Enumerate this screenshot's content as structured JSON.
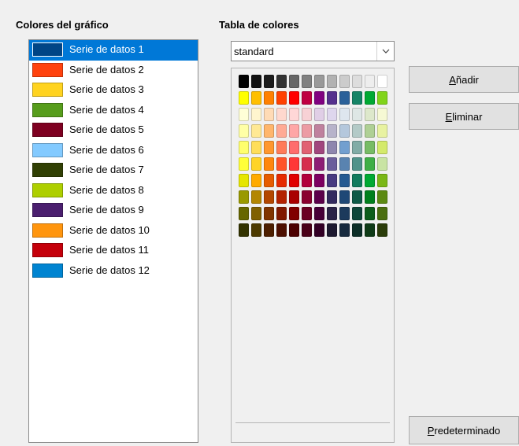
{
  "left_panel": {
    "title": "Colores del gráfico",
    "selected_index": 0,
    "series": [
      {
        "label": "Serie de datos 1",
        "color": "#004586"
      },
      {
        "label": "Serie de datos 2",
        "color": "#ff420e"
      },
      {
        "label": "Serie de datos 3",
        "color": "#ffd320"
      },
      {
        "label": "Serie de datos 4",
        "color": "#579d1c"
      },
      {
        "label": "Serie de datos 5",
        "color": "#7e0021"
      },
      {
        "label": "Serie de datos 6",
        "color": "#83caff"
      },
      {
        "label": "Serie de datos 7",
        "color": "#314004"
      },
      {
        "label": "Serie de datos 8",
        "color": "#aecf00"
      },
      {
        "label": "Serie de datos 9",
        "color": "#4b1f6f"
      },
      {
        "label": "Serie de datos 10",
        "color": "#ff950e"
      },
      {
        "label": "Serie de datos 11",
        "color": "#c5000b"
      },
      {
        "label": "Serie de datos 12",
        "color": "#0084d1"
      }
    ]
  },
  "right_panel": {
    "title": "Tabla de colores",
    "palette_select": {
      "value": "standard"
    },
    "palette_rows": [
      [
        "#000000",
        "#111111",
        "#1c1c1c",
        "#333333",
        "#666666",
        "#808080",
        "#999999",
        "#b2b2b2",
        "#cccccc",
        "#dddddd",
        "#eeeeee",
        "#ffffff"
      ],
      [
        "#ffff00",
        "#ffbf00",
        "#ff8000",
        "#ff4000",
        "#ff0000",
        "#bf0041",
        "#800080",
        "#55308d",
        "#2a6099",
        "#158466",
        "#00a933",
        "#81d41a"
      ],
      [
        "#ffffd7",
        "#fff5ce",
        "#ffdbb6",
        "#ffd8ce",
        "#ffd7d7",
        "#f7d1d5",
        "#e0cee6",
        "#ded6ed",
        "#dee6ef",
        "#dee7e5",
        "#dde8cb",
        "#f6f9d4"
      ],
      [
        "#ffffa6",
        "#ffe994",
        "#ffb66c",
        "#ffaa95",
        "#ffa6a6",
        "#ec9ba4",
        "#bf819e",
        "#b7b3ca",
        "#b4c7dc",
        "#b3cac7",
        "#afd095",
        "#e8f2a1"
      ],
      [
        "#ffff6d",
        "#ffde59",
        "#ff972f",
        "#ff7b59",
        "#ff6d6d",
        "#e16173",
        "#a1467e",
        "#8e86ae",
        "#729fcf",
        "#81aca6",
        "#77bc65",
        "#d4ea6b"
      ],
      [
        "#ffff38",
        "#ffd428",
        "#ff860d",
        "#ff5429",
        "#ff3838",
        "#d62e4e",
        "#8d1d75",
        "#6b5e9b",
        "#5983b0",
        "#50938a",
        "#3faf46",
        "#c9e4a4"
      ],
      [
        "#e6e600",
        "#ffaa00",
        "#e65c00",
        "#e62b00",
        "#e00000",
        "#b2003c",
        "#7d0061",
        "#473a80",
        "#265a91",
        "#137b5e",
        "#00a933",
        "#7ab717"
      ],
      [
        "#999900",
        "#b38600",
        "#b34700",
        "#b32200",
        "#a90000",
        "#8a002f",
        "#5c004a",
        "#332a5e",
        "#1f4876",
        "#0e5a47",
        "#00801d",
        "#5c8a12"
      ],
      [
        "#666600",
        "#806000",
        "#803400",
        "#801900",
        "#800000",
        "#6a0023",
        "#470038",
        "#2b2347",
        "#1c3a5c",
        "#0f463a",
        "#0d5d1c",
        "#4a6e0f"
      ],
      [
        "#333300",
        "#4d3a00",
        "#4d1f00",
        "#4d0f00",
        "#4c0000",
        "#4a0018",
        "#330025",
        "#1e1a30",
        "#172a3e",
        "#0d2f28",
        "#0f3b17",
        "#2b3d0a"
      ]
    ]
  },
  "buttons": {
    "add": {
      "mnemonic": "A",
      "rest": "ñadir"
    },
    "delete": {
      "mnemonic": "E",
      "rest": "liminar"
    },
    "default": {
      "mnemonic": "P",
      "rest": "redeterminado"
    }
  }
}
